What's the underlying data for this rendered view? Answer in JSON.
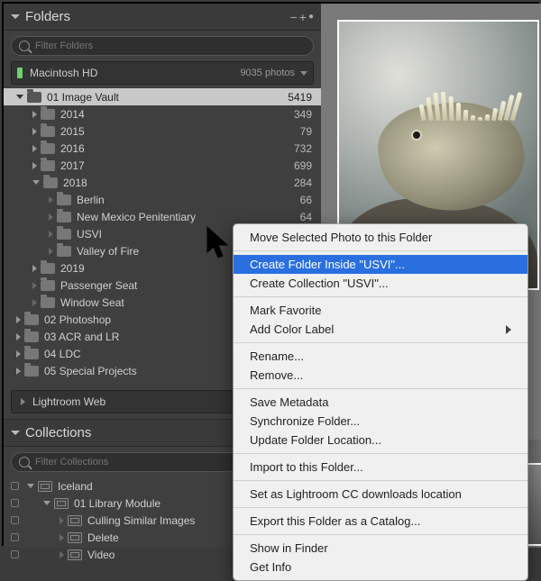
{
  "panels": {
    "folders": {
      "title": "Folders",
      "filter_placeholder": "Filter Folders"
    },
    "collections": {
      "title": "Collections",
      "filter_placeholder": "Filter Collections"
    }
  },
  "volume": {
    "name": "Macintosh HD",
    "count": "9035 photos"
  },
  "tree": [
    {
      "depth": 0,
      "label": "01 Image Vault",
      "count": "5419",
      "open": true,
      "selected": true
    },
    {
      "depth": 1,
      "label": "2014",
      "count": "349",
      "open": false
    },
    {
      "depth": 1,
      "label": "2015",
      "count": "79",
      "open": false
    },
    {
      "depth": 1,
      "label": "2016",
      "count": "732",
      "open": false
    },
    {
      "depth": 1,
      "label": "2017",
      "count": "699",
      "open": false
    },
    {
      "depth": 1,
      "label": "2018",
      "count": "284",
      "open": true
    },
    {
      "depth": 2,
      "label": "Berlin",
      "count": "66",
      "leaf": true
    },
    {
      "depth": 2,
      "label": "New Mexico Penitentiary",
      "count": "64",
      "leaf": true
    },
    {
      "depth": 2,
      "label": "USVI",
      "count": "",
      "leaf": true
    },
    {
      "depth": 2,
      "label": "Valley of Fire",
      "count": "",
      "leaf": true
    },
    {
      "depth": 1,
      "label": "2019",
      "count": "",
      "open": false
    },
    {
      "depth": 1,
      "label": "Passenger Seat",
      "count": "",
      "leaf": true
    },
    {
      "depth": 1,
      "label": "Window Seat",
      "count": "",
      "leaf": true
    },
    {
      "depth": 0,
      "label": "02 Photoshop",
      "count": "",
      "open": false
    },
    {
      "depth": 0,
      "label": "03 ACR and LR",
      "count": "",
      "open": false
    },
    {
      "depth": 0,
      "label": "04 LDC",
      "count": "",
      "open": false
    },
    {
      "depth": 0,
      "label": "05 Special Projects",
      "count": "",
      "open": false
    }
  ],
  "lrweb": {
    "label": "Lightroom Web"
  },
  "collections": [
    {
      "depth": 0,
      "label": "Iceland",
      "open": true,
      "set": true
    },
    {
      "depth": 1,
      "label": "01 Library Module",
      "open": true,
      "set": true
    },
    {
      "depth": 2,
      "label": "Culling Similar Images",
      "leaf": true
    },
    {
      "depth": 2,
      "label": "Delete",
      "leaf": true
    },
    {
      "depth": 2,
      "label": "Video",
      "leaf": true
    }
  ],
  "context_menu": {
    "items": [
      {
        "label": "Move Selected Photo to this Folder"
      },
      {
        "sep": true
      },
      {
        "label": "Create Folder Inside \"USVI\"...",
        "highlight": true
      },
      {
        "label": "Create Collection \"USVI\"..."
      },
      {
        "sep": true
      },
      {
        "label": "Mark Favorite"
      },
      {
        "label": "Add Color Label",
        "submenu": true
      },
      {
        "sep": true
      },
      {
        "label": "Rename..."
      },
      {
        "label": "Remove..."
      },
      {
        "sep": true
      },
      {
        "label": "Save Metadata"
      },
      {
        "label": "Synchronize Folder..."
      },
      {
        "label": "Update Folder Location..."
      },
      {
        "sep": true
      },
      {
        "label": "Import to this Folder..."
      },
      {
        "sep": true
      },
      {
        "label": "Set as Lightroom CC downloads location"
      },
      {
        "sep": true
      },
      {
        "label": "Export this Folder as a Catalog..."
      },
      {
        "sep": true
      },
      {
        "label": "Show in Finder"
      },
      {
        "label": "Get Info"
      }
    ]
  }
}
